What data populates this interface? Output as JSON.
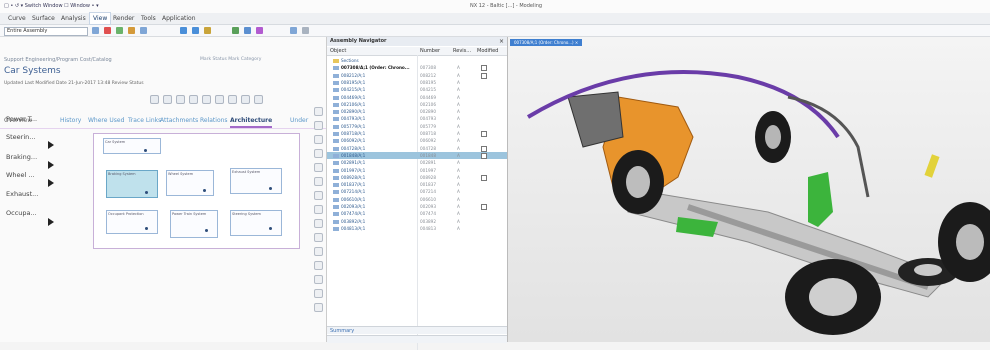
{
  "titlebar": {
    "quick_access": "□ • ↺ ▾ Switch Window ☐ Window • ▾",
    "app_title": "NX 12 - Baltic [...] - Modeling"
  },
  "menus": [
    "Curve",
    "Surface",
    "Analysis",
    "View",
    "Render",
    "Tools",
    "Application"
  ],
  "toolbar": {
    "scope": "Entire Assembly"
  },
  "left_panel": {
    "header_path": "Support Engineering/Program Cost/Catalog",
    "name": "Car Systems",
    "meta": "Updated   Last Modified Date  21-Jun-2017 13:48  Review Status",
    "attrs": "Mark Status    Mark Category",
    "tabs": [
      "Overview",
      "History",
      "Where Used",
      "Trace Links",
      "Attachments",
      "Relations",
      "Architecture",
      "Under"
    ],
    "side_items": [
      "Power T...",
      "Steerin...",
      "Braking...",
      "Wheel ...",
      "Exhaust...",
      "Occupa..."
    ],
    "diagram": {
      "title": "Car System",
      "boxes": [
        {
          "label": "Braking System"
        },
        {
          "label": "Wheel System"
        },
        {
          "label": "Exhaust System"
        },
        {
          "label": "Occupant Protection"
        },
        {
          "label": "Power Train System"
        },
        {
          "label": "Steering System"
        },
        {
          "label": "Body System"
        }
      ]
    }
  },
  "navigator": {
    "title": "Assembly Navigator",
    "columns": [
      "Object",
      "Number",
      "Revis...",
      "Modified"
    ],
    "rows": [
      {
        "name": "Sections",
        "num": "",
        "rev": "",
        "mod": false,
        "fold": true
      },
      {
        "name": "007308/A;1 (Order: Chrono...",
        "num": "007308",
        "rev": "A",
        "mod": true,
        "bold": true
      },
      {
        "name": "008212/A;1",
        "num": "008212",
        "rev": "A",
        "mod": true
      },
      {
        "name": "008195/A;1",
        "num": "008195",
        "rev": "A",
        "mod": false
      },
      {
        "name": "004215/A;1",
        "num": "004215",
        "rev": "A",
        "mod": false
      },
      {
        "name": "004469/A;1",
        "num": "004469",
        "rev": "A",
        "mod": false
      },
      {
        "name": "002106/A;1",
        "num": "002106",
        "rev": "A",
        "mod": false
      },
      {
        "name": "002890/A;1",
        "num": "002890",
        "rev": "A",
        "mod": false
      },
      {
        "name": "004793/A;1",
        "num": "004793",
        "rev": "A",
        "mod": false
      },
      {
        "name": "005779/A;1",
        "num": "005779",
        "rev": "A",
        "mod": false
      },
      {
        "name": "008718/A;1",
        "num": "008718",
        "rev": "A",
        "mod": true
      },
      {
        "name": "006092/A;1",
        "num": "006092",
        "rev": "A",
        "mod": false
      },
      {
        "name": "004728/A;1",
        "num": "004728",
        "rev": "A",
        "mod": true
      },
      {
        "name": "001848/A;1",
        "num": "001848",
        "rev": "A",
        "mod": true,
        "selected": true
      },
      {
        "name": "002891/A;1",
        "num": "002891",
        "rev": "A",
        "mod": false
      },
      {
        "name": "001997/A;1",
        "num": "001997",
        "rev": "A",
        "mod": false
      },
      {
        "name": "008928/A;1",
        "num": "008928",
        "rev": "A",
        "mod": true
      },
      {
        "name": "001837/A;1",
        "num": "001837",
        "rev": "A",
        "mod": false
      },
      {
        "name": "007214/A;1",
        "num": "007214",
        "rev": "A",
        "mod": false
      },
      {
        "name": "006610/A;1",
        "num": "006610",
        "rev": "A",
        "mod": false
      },
      {
        "name": "002093/A;1",
        "num": "002093",
        "rev": "A",
        "mod": true
      },
      {
        "name": "007474/A;1",
        "num": "007474",
        "rev": "A",
        "mod": false
      },
      {
        "name": "003892/A;1",
        "num": "003892",
        "rev": "A",
        "mod": false
      },
      {
        "name": "004813/A;1",
        "num": "004813",
        "rev": "A",
        "mod": false
      }
    ],
    "summary_label": "Summary"
  },
  "viewport": {
    "tab_label": "007308/A;1 (Order: Chrono...) ×"
  },
  "colors": {
    "accent": "#3f7fd0",
    "purple": "#a36ac8",
    "orange": "#e8942c",
    "selection": "#9cc4dd"
  }
}
